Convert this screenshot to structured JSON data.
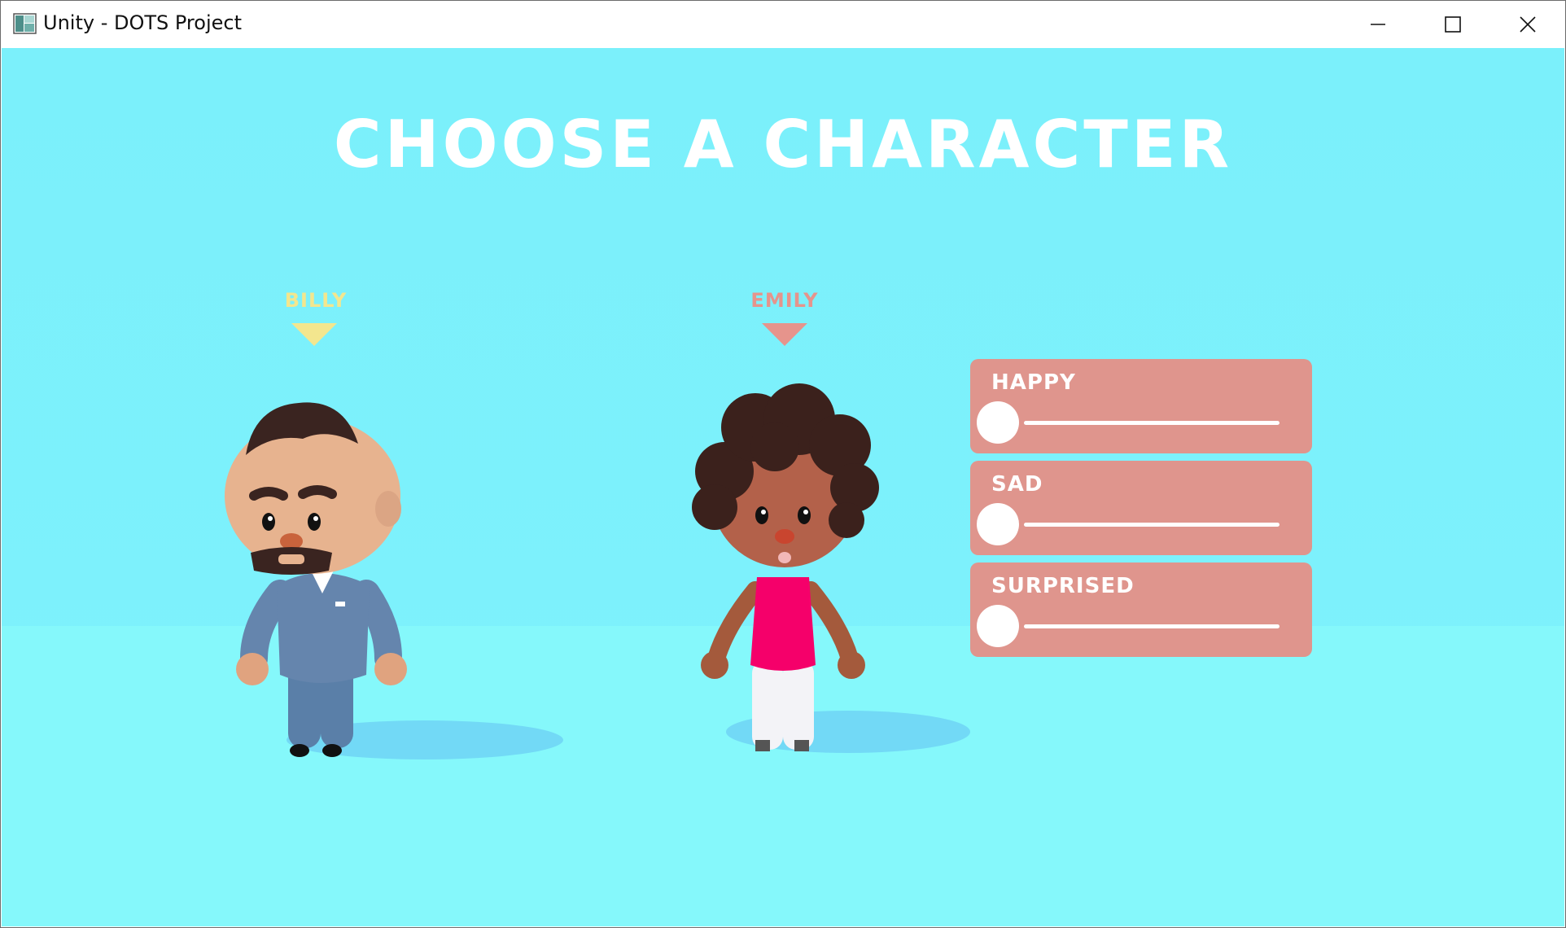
{
  "window": {
    "title": "Unity - DOTS Project",
    "controls": {
      "minimize": "minimize-icon",
      "maximize": "maximize-icon",
      "close": "close-icon"
    }
  },
  "screen": {
    "heading": "CHOOSE A CHARACTER"
  },
  "characters": [
    {
      "name": "BILLY",
      "color": "#f3e68e"
    },
    {
      "name": "EMILY",
      "color": "#e6948c"
    }
  ],
  "emotion_panel": {
    "color": "#df958d",
    "sliders": [
      {
        "label": "HAPPY",
        "value": 0
      },
      {
        "label": "SAD",
        "value": 0
      },
      {
        "label": "SURPRISED",
        "value": 0
      }
    ]
  }
}
